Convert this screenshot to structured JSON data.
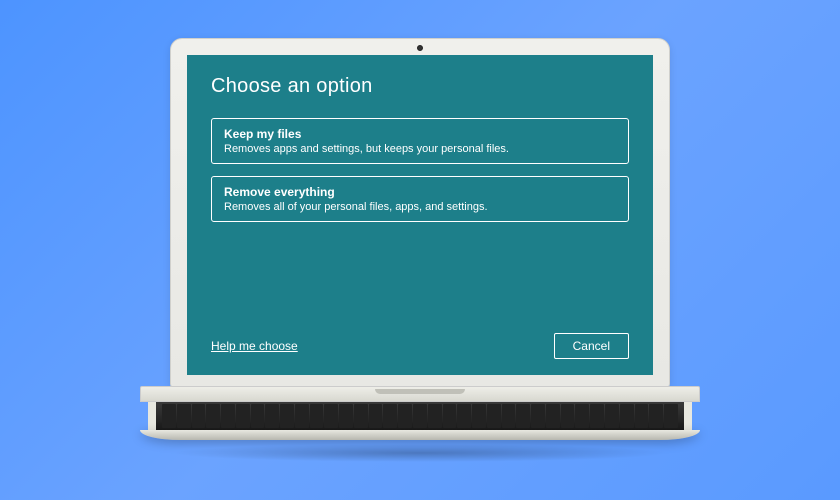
{
  "dialog": {
    "title": "Choose an option",
    "options": [
      {
        "title": "Keep my files",
        "description": "Removes apps and settings, but keeps your personal files."
      },
      {
        "title": "Remove everything",
        "description": "Removes all of your personal files, apps, and settings."
      }
    ],
    "help_link": "Help me choose",
    "cancel_label": "Cancel"
  }
}
